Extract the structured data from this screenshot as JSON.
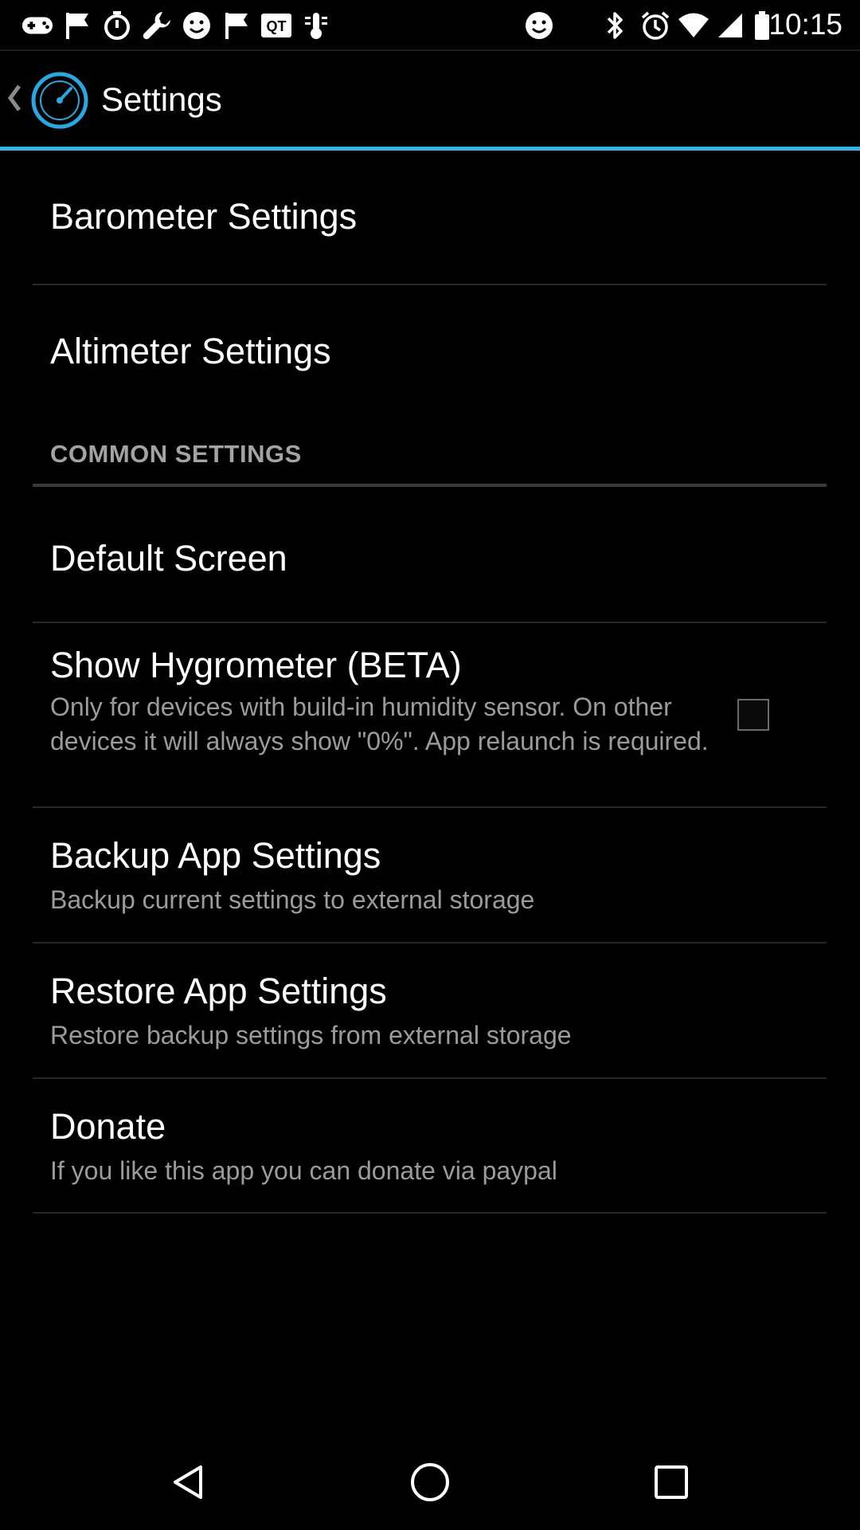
{
  "status_bar": {
    "time": "10:15",
    "left_icons": [
      "gamepad-icon",
      "flag-icon",
      "stopwatch-icon",
      "wrench-icon",
      "smiley-icon",
      "flag-icon",
      "qt-app-icon",
      "thermometer-app-icon",
      "smiley-icon"
    ],
    "right_icons": [
      "bluetooth-icon",
      "alarm-icon",
      "wifi-icon",
      "signal-icon",
      "battery-icon"
    ]
  },
  "action_bar": {
    "title": "Settings",
    "accent_color": "#33b5e5"
  },
  "preferences": {
    "barometer": {
      "title": "Barometer Settings"
    },
    "altimeter": {
      "title": "Altimeter Settings"
    },
    "category": {
      "title": "COMMON SETTINGS"
    },
    "default_screen": {
      "title": "Default Screen"
    },
    "hygrometer": {
      "title": "Show Hygrometer (BETA)",
      "summary": "Only for devices with build-in humidity sensor. On other devices it will always show \"0%\". App relaunch is required.",
      "checked": false
    },
    "backup": {
      "title": "Backup App Settings",
      "summary": "Backup current settings to external storage"
    },
    "restore": {
      "title": "Restore App Settings",
      "summary": "Restore backup settings from external storage"
    },
    "donate": {
      "title": "Donate",
      "summary": "If you like this app you can donate via paypal"
    }
  },
  "nav_bar": {
    "buttons": [
      "back-icon",
      "home-icon",
      "recents-icon"
    ]
  }
}
